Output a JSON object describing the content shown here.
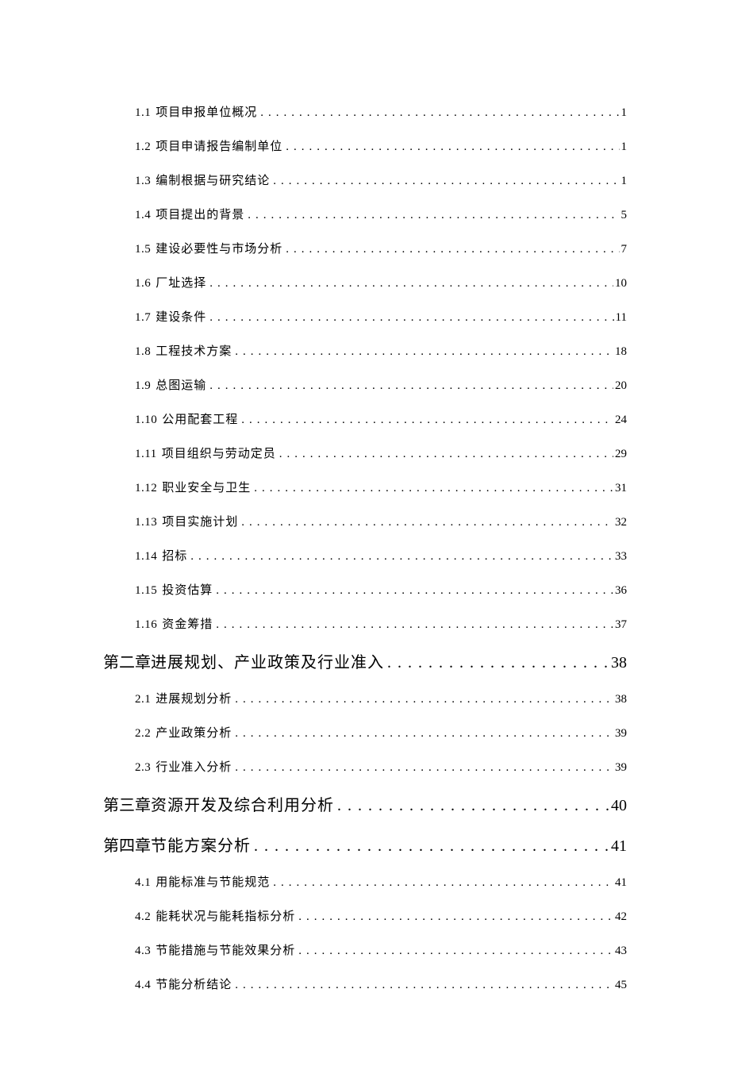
{
  "toc": [
    {
      "level": "sub",
      "num": "1.1",
      "title": "项目申报单位概况",
      "page": "1"
    },
    {
      "level": "sub",
      "num": "1.2",
      "title": "项目申请报告编制单位",
      "page": "1"
    },
    {
      "level": "sub",
      "num": "1.3",
      "title": "编制根据与研究结论",
      "page": "1"
    },
    {
      "level": "sub",
      "num": "1.4",
      "title": "项目提出的背景",
      "page": "5"
    },
    {
      "level": "sub",
      "num": "1.5",
      "title": "建设必要性与市场分析",
      "page": "7"
    },
    {
      "level": "sub",
      "num": "1.6",
      "title": "厂址选择",
      "page": "10"
    },
    {
      "level": "sub",
      "num": "1.7",
      "title": "建设条件",
      "page": "11"
    },
    {
      "level": "sub",
      "num": "1.8",
      "title": "工程技术方案",
      "page": "18"
    },
    {
      "level": "sub",
      "num": "1.9",
      "title": "总图运输",
      "page": "20"
    },
    {
      "level": "sub",
      "num": "1.10",
      "title": "公用配套工程",
      "page": "24"
    },
    {
      "level": "sub",
      "num": "1.11",
      "title": "项目组织与劳动定员",
      "page": "29"
    },
    {
      "level": "sub",
      "num": "1.12",
      "title": "职业安全与卫生",
      "page": "31"
    },
    {
      "level": "sub",
      "num": "1.13",
      "title": "项目实施计划",
      "page": "32"
    },
    {
      "level": "sub",
      "num": "1.14",
      "title": "招标",
      "page": "33"
    },
    {
      "level": "sub",
      "num": "1.15",
      "title": "投资估算",
      "page": "36"
    },
    {
      "level": "sub",
      "num": "1.16",
      "title": "资金筹措",
      "page": "37"
    },
    {
      "level": "chapter",
      "num": "第二章",
      "title": "进展规划、产业政策及行业准入",
      "page": "38"
    },
    {
      "level": "sub",
      "num": "2.1",
      "title": "进展规划分析",
      "page": "38"
    },
    {
      "level": "sub",
      "num": "2.2",
      "title": "产业政策分析",
      "page": "39"
    },
    {
      "level": "sub",
      "num": "2.3",
      "title": "行业准入分析",
      "page": "39"
    },
    {
      "level": "chapter",
      "num": "第三章",
      "title": "资源开发及综合利用分析",
      "page": "40"
    },
    {
      "level": "chapter",
      "num": "第四章",
      "title": "节能方案分析",
      "page": "41"
    },
    {
      "level": "sub",
      "num": "4.1",
      "title": "用能标准与节能规范",
      "page": "41"
    },
    {
      "level": "sub",
      "num": "4.2",
      "title": "能耗状况与能耗指标分析",
      "page": "42"
    },
    {
      "level": "sub",
      "num": "4.3",
      "title": "节能措施与节能效果分析",
      "page": "43"
    },
    {
      "level": "sub",
      "num": "4.4",
      "title": "节能分析结论",
      "page": "45"
    }
  ],
  "leader_dots": ".................................................................................................."
}
